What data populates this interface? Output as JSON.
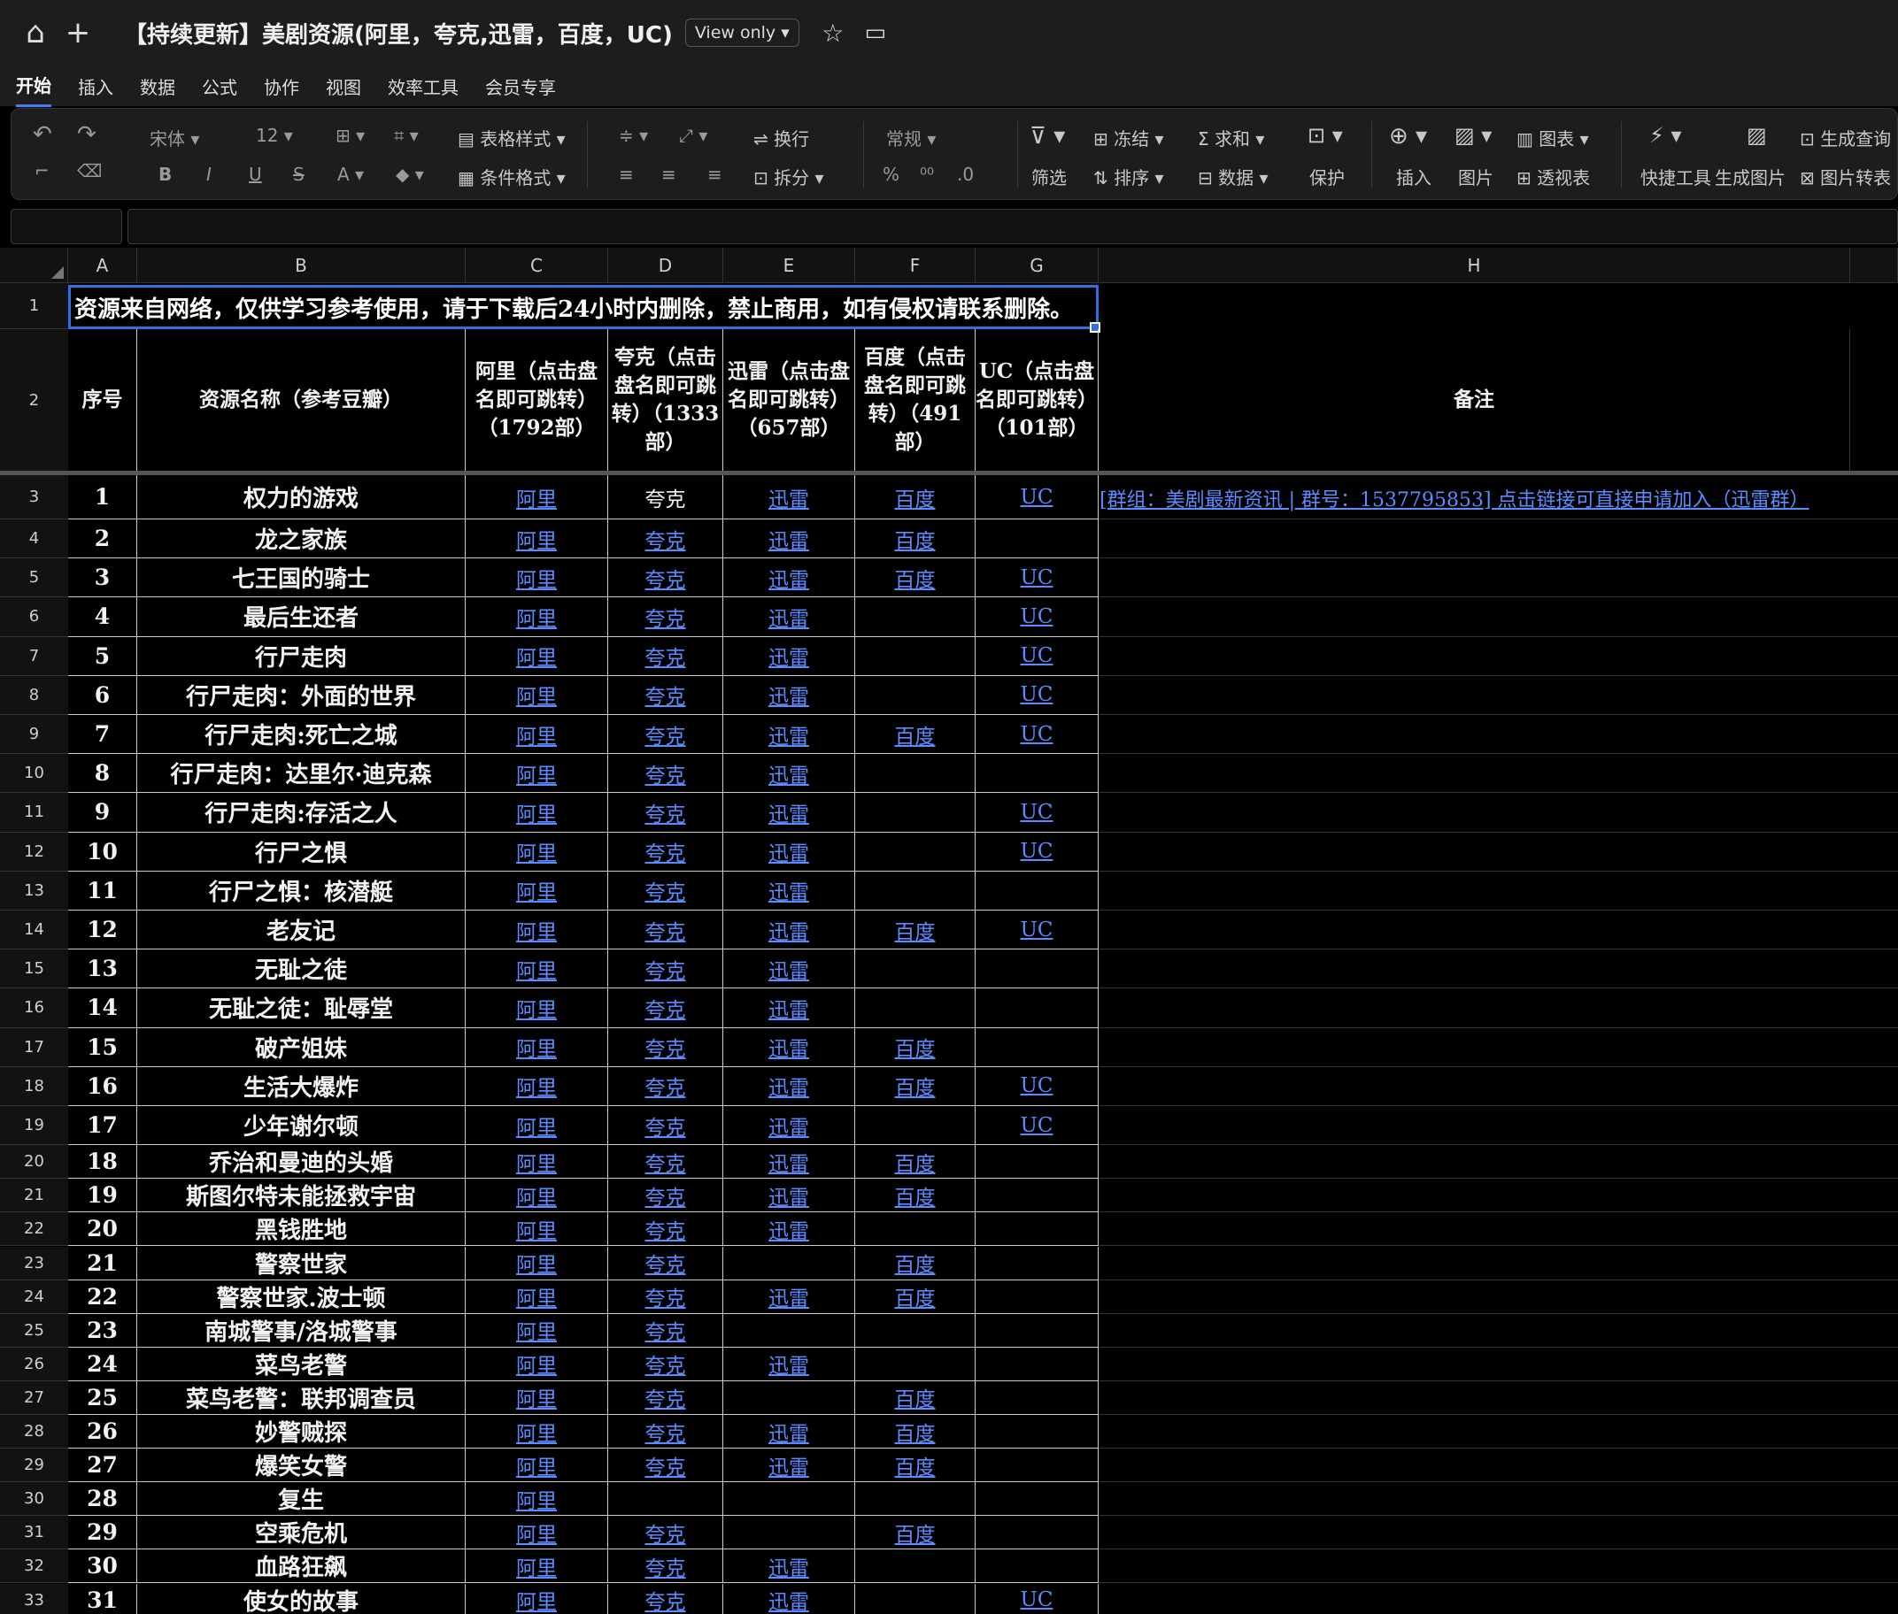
{
  "app": {
    "doc_title": "【持续更新】美剧资源(阿里，夸克,迅雷，百度，UC)",
    "view_mode": "View only ▾"
  },
  "menu": [
    "开始",
    "插入",
    "数据",
    "公式",
    "协作",
    "视图",
    "效率工具",
    "会员专享"
  ],
  "toolbar": {
    "font": "宋体",
    "size": "12",
    "table_style": "表格样式",
    "cond_format": "条件格式",
    "wrap": "换行",
    "split": "拆分",
    "number_format": "常规",
    "percent": "%",
    "thousands": "⁰⁰",
    "decimal": ".0",
    "filter": "筛选",
    "freeze": "冻结",
    "sort": "排序",
    "sum": "求和",
    "data": "数据",
    "protect": "保护",
    "insert": "插入",
    "image": "图片",
    "chart": "图表",
    "pivot": "透视表",
    "quick_tools": "快捷工具",
    "gen_image": "生成图片",
    "gen_query": "生成查询",
    "img_convert": "图片转表"
  },
  "columns": [
    "A",
    "B",
    "C",
    "D",
    "E",
    "F",
    "G",
    "H"
  ],
  "notice": "资源来自网络，仅供学习参考使用，请于下载后24小时内删除，禁止商用，如有侵权请联系删除。",
  "headers": {
    "seq": "序号",
    "name": "资源名称（参考豆瓣）",
    "ali": "阿里（点击盘名即可跳转）（1792部）",
    "quark": "夸克（点击盘名即可跳转）（1333部）",
    "xunlei": "迅雷（点击盘名即可跳转）（657部）",
    "baidu": "百度（点击盘名即可跳转）（491部）",
    "uc": "UC（点击盘名即可跳转）（101部）",
    "remark": "备注"
  },
  "remark_row3": "[群组：美剧最新资讯 | 群号：1537795853] 点击链接可直接申请加入（迅雷群）",
  "rows": [
    {
      "n": "1",
      "name": "权力的游戏",
      "ali": "阿里",
      "quark": "夸克",
      "xunlei": "迅雷",
      "baidu": "百度",
      "uc": "UC"
    },
    {
      "n": "2",
      "name": "龙之家族",
      "ali": "阿里",
      "quark": "夸克",
      "xunlei": "迅雷",
      "baidu": "百度",
      "uc": ""
    },
    {
      "n": "3",
      "name": "七王国的骑士",
      "ali": "阿里",
      "quark": "夸克",
      "xunlei": "迅雷",
      "baidu": "百度",
      "uc": "UC"
    },
    {
      "n": "4",
      "name": "最后生还者",
      "ali": "阿里",
      "quark": "夸克",
      "xunlei": "迅雷",
      "baidu": "",
      "uc": "UC"
    },
    {
      "n": "5",
      "name": "行尸走肉",
      "ali": "阿里",
      "quark": "夸克",
      "xunlei": "迅雷",
      "baidu": "",
      "uc": "UC"
    },
    {
      "n": "6",
      "name": "行尸走肉：外面的世界",
      "ali": "阿里",
      "quark": "夸克",
      "xunlei": "迅雷",
      "baidu": "",
      "uc": "UC"
    },
    {
      "n": "7",
      "name": "行尸走肉:死亡之城",
      "ali": "阿里",
      "quark": "夸克",
      "xunlei": "迅雷",
      "baidu": "百度",
      "uc": "UC"
    },
    {
      "n": "8",
      "name": "行尸走肉：达里尔·迪克森",
      "ali": "阿里",
      "quark": "夸克",
      "xunlei": "迅雷",
      "baidu": "",
      "uc": ""
    },
    {
      "n": "9",
      "name": "行尸走肉:存活之人",
      "ali": "阿里",
      "quark": "夸克",
      "xunlei": "迅雷",
      "baidu": "",
      "uc": "UC"
    },
    {
      "n": "10",
      "name": "行尸之惧",
      "ali": "阿里",
      "quark": "夸克",
      "xunlei": "迅雷",
      "baidu": "",
      "uc": "UC"
    },
    {
      "n": "11",
      "name": "行尸之惧：核潜艇",
      "ali": "阿里",
      "quark": "夸克",
      "xunlei": "迅雷",
      "baidu": "",
      "uc": ""
    },
    {
      "n": "12",
      "name": "老友记",
      "ali": "阿里",
      "quark": "夸克",
      "xunlei": "迅雷",
      "baidu": "百度",
      "uc": "UC"
    },
    {
      "n": "13",
      "name": "无耻之徒",
      "ali": "阿里",
      "quark": "夸克",
      "xunlei": "迅雷",
      "baidu": "",
      "uc": ""
    },
    {
      "n": "14",
      "name": "无耻之徒：耻辱堂",
      "ali": "阿里",
      "quark": "夸克",
      "xunlei": "迅雷",
      "baidu": "",
      "uc": ""
    },
    {
      "n": "15",
      "name": "破产姐妹",
      "ali": "阿里",
      "quark": "夸克",
      "xunlei": "迅雷",
      "baidu": "百度",
      "uc": ""
    },
    {
      "n": "16",
      "name": "生活大爆炸",
      "ali": "阿里",
      "quark": "夸克",
      "xunlei": "迅雷",
      "baidu": "百度",
      "uc": "UC"
    },
    {
      "n": "17",
      "name": "少年谢尔顿",
      "ali": "阿里",
      "quark": "夸克",
      "xunlei": "迅雷",
      "baidu": "",
      "uc": "UC"
    },
    {
      "n": "18",
      "name": "乔治和曼迪的头婚",
      "ali": "阿里",
      "quark": "夸克",
      "xunlei": "迅雷",
      "baidu": "百度",
      "uc": ""
    },
    {
      "n": "19",
      "name": "斯图尔特未能拯救宇宙",
      "ali": "阿里",
      "quark": "夸克",
      "xunlei": "迅雷",
      "baidu": "百度",
      "uc": ""
    },
    {
      "n": "20",
      "name": "黑钱胜地",
      "ali": "阿里",
      "quark": "夸克",
      "xunlei": "迅雷",
      "baidu": "",
      "uc": ""
    },
    {
      "n": "21",
      "name": "警察世家",
      "ali": "阿里",
      "quark": "夸克",
      "xunlei": "",
      "baidu": "百度",
      "uc": ""
    },
    {
      "n": "22",
      "name": "警察世家.波士顿",
      "ali": "阿里",
      "quark": "夸克",
      "xunlei": "迅雷",
      "baidu": "百度",
      "uc": ""
    },
    {
      "n": "23",
      "name": "南城警事/洛城警事",
      "ali": "阿里",
      "quark": "夸克",
      "xunlei": "",
      "baidu": "",
      "uc": ""
    },
    {
      "n": "24",
      "name": "菜鸟老警",
      "ali": "阿里",
      "quark": "夸克",
      "xunlei": "迅雷",
      "baidu": "",
      "uc": ""
    },
    {
      "n": "25",
      "name": "菜鸟老警：联邦调查员",
      "ali": "阿里",
      "quark": "夸克",
      "xunlei": "",
      "baidu": "百度",
      "uc": ""
    },
    {
      "n": "26",
      "name": "妙警贼探",
      "ali": "阿里",
      "quark": "夸克",
      "xunlei": "迅雷",
      "baidu": "百度",
      "uc": ""
    },
    {
      "n": "27",
      "name": "爆笑女警",
      "ali": "阿里",
      "quark": "夸克",
      "xunlei": "迅雷",
      "baidu": "百度",
      "uc": ""
    },
    {
      "n": "28",
      "name": "复生",
      "ali": "阿里",
      "quark": "",
      "xunlei": "",
      "baidu": "",
      "uc": ""
    },
    {
      "n": "29",
      "name": "空乘危机",
      "ali": "阿里",
      "quark": "夸克",
      "xunlei": "",
      "baidu": "百度",
      "uc": ""
    },
    {
      "n": "30",
      "name": "血路狂飙",
      "ali": "阿里",
      "quark": "夸克",
      "xunlei": "迅雷",
      "baidu": "",
      "uc": ""
    },
    {
      "n": "31",
      "name": "使女的故事",
      "ali": "阿里",
      "quark": "夸克",
      "xunlei": "迅雷",
      "baidu": "",
      "uc": "UC"
    }
  ]
}
